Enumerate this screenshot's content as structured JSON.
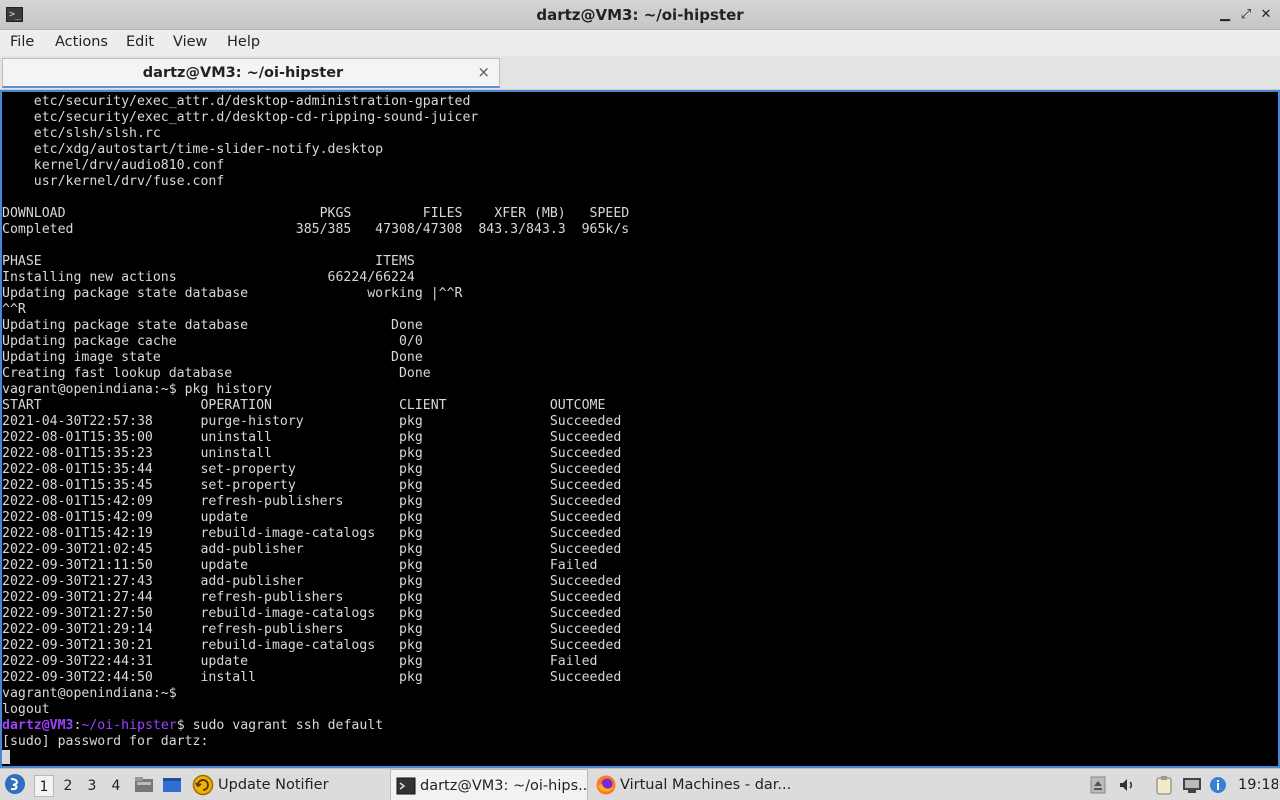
{
  "window": {
    "title": "dartz@VM3: ~/oi-hipster"
  },
  "menu": [
    "File",
    "Actions",
    "Edit",
    "View",
    "Help"
  ],
  "tab": {
    "label": "dartz@VM3: ~/oi-hipster",
    "close_glyph": "×"
  },
  "terminal": {
    "lines": [
      "    etc/security/exec_attr.d/desktop-administration-gparted",
      "    etc/security/exec_attr.d/desktop-cd-ripping-sound-juicer",
      "    etc/slsh/slsh.rc",
      "    etc/xdg/autostart/time-slider-notify.desktop",
      "    kernel/drv/audio810.conf",
      "    usr/kernel/drv/fuse.conf",
      "",
      "DOWNLOAD                                PKGS         FILES    XFER (MB)   SPEED",
      "Completed                            385/385   47308/47308  843.3/843.3  965k/s",
      "",
      "PHASE                                          ITEMS",
      "Installing new actions                   66224/66224",
      "Updating package state database               working |^^R",
      "^^R",
      "Updating package state database                  Done",
      "Updating package cache                            0/0",
      "Updating image state                             Done",
      "Creating fast lookup database                     Done",
      "vagrant@openindiana:~$ pkg history",
      "START                    OPERATION                CLIENT             OUTCOME",
      "2021-04-30T22:57:38      purge-history            pkg                Succeeded",
      "2022-08-01T15:35:00      uninstall                pkg                Succeeded",
      "2022-08-01T15:35:23      uninstall                pkg                Succeeded",
      "2022-08-01T15:35:44      set-property             pkg                Succeeded",
      "2022-08-01T15:35:45      set-property             pkg                Succeeded",
      "2022-08-01T15:42:09      refresh-publishers       pkg                Succeeded",
      "2022-08-01T15:42:09      update                   pkg                Succeeded",
      "2022-08-01T15:42:19      rebuild-image-catalogs   pkg                Succeeded",
      "2022-09-30T21:02:45      add-publisher            pkg                Succeeded",
      "2022-09-30T21:11:50      update                   pkg                Failed",
      "2022-09-30T21:27:43      add-publisher            pkg                Succeeded",
      "2022-09-30T21:27:44      refresh-publishers       pkg                Succeeded",
      "2022-09-30T21:27:50      rebuild-image-catalogs   pkg                Succeeded",
      "2022-09-30T21:29:14      refresh-publishers       pkg                Succeeded",
      "2022-09-30T21:30:21      rebuild-image-catalogs   pkg                Succeeded",
      "2022-09-30T22:44:31      update                   pkg                Failed",
      "2022-09-30T22:44:50      install                  pkg                Succeeded",
      "vagrant@openindiana:~$",
      "logout"
    ],
    "prompt": {
      "user": "dartz@VM3",
      "sep": ":",
      "path": "~/oi-hipster",
      "dollar": "$",
      "command": " sudo vagrant ssh default"
    },
    "password_prompt": "[sudo] password for dartz:"
  },
  "taskbar": {
    "workspaces": [
      "1",
      "2",
      "3",
      "4"
    ],
    "active_workspace": "1",
    "tasks": [
      {
        "label": "Update Notifier",
        "icon": "update-notifier-icon"
      },
      {
        "label": "dartz@VM3: ~/oi-hips...",
        "icon": "terminal-icon"
      },
      {
        "label": "Virtual Machines - dar...",
        "icon": "firefox-icon"
      }
    ],
    "clock": "19:18"
  },
  "colors": {
    "prompt": "#a040ff",
    "terminal_bg": "#000000",
    "focus_border": "#4b86d4"
  }
}
